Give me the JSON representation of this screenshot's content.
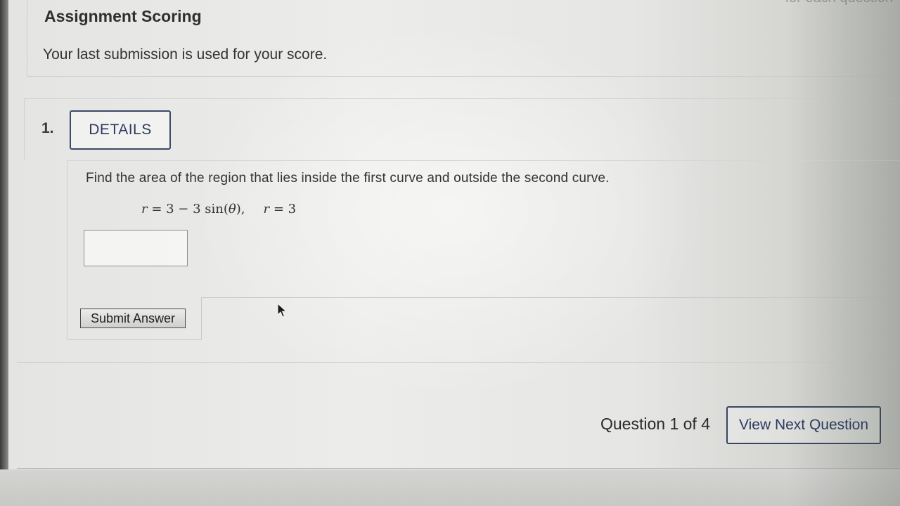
{
  "top_cut_text": "for each question",
  "scoring": {
    "title": "Assignment Scoring",
    "text": "Your last submission is used for your score."
  },
  "question": {
    "number": "1.",
    "details_label": "DETAILS",
    "prompt": "Find the area of the region that lies inside the first curve and outside the second curve.",
    "equation": {
      "curve1_var": "r",
      "curve1_rhs": " = 3 − 3 sin(",
      "theta": "θ",
      "curve1_end": "),",
      "curve2_var": "r",
      "curve2_rhs": " = 3"
    },
    "answer_value": "",
    "submit_label": "Submit Answer"
  },
  "navigation": {
    "count_text": "Question 1 of 4",
    "next_label": "View Next Question"
  },
  "icons": {
    "cursor": "mouse-pointer-icon"
  },
  "colors": {
    "button_border": "#3d4a66",
    "button_text": "#2c3a5c"
  }
}
